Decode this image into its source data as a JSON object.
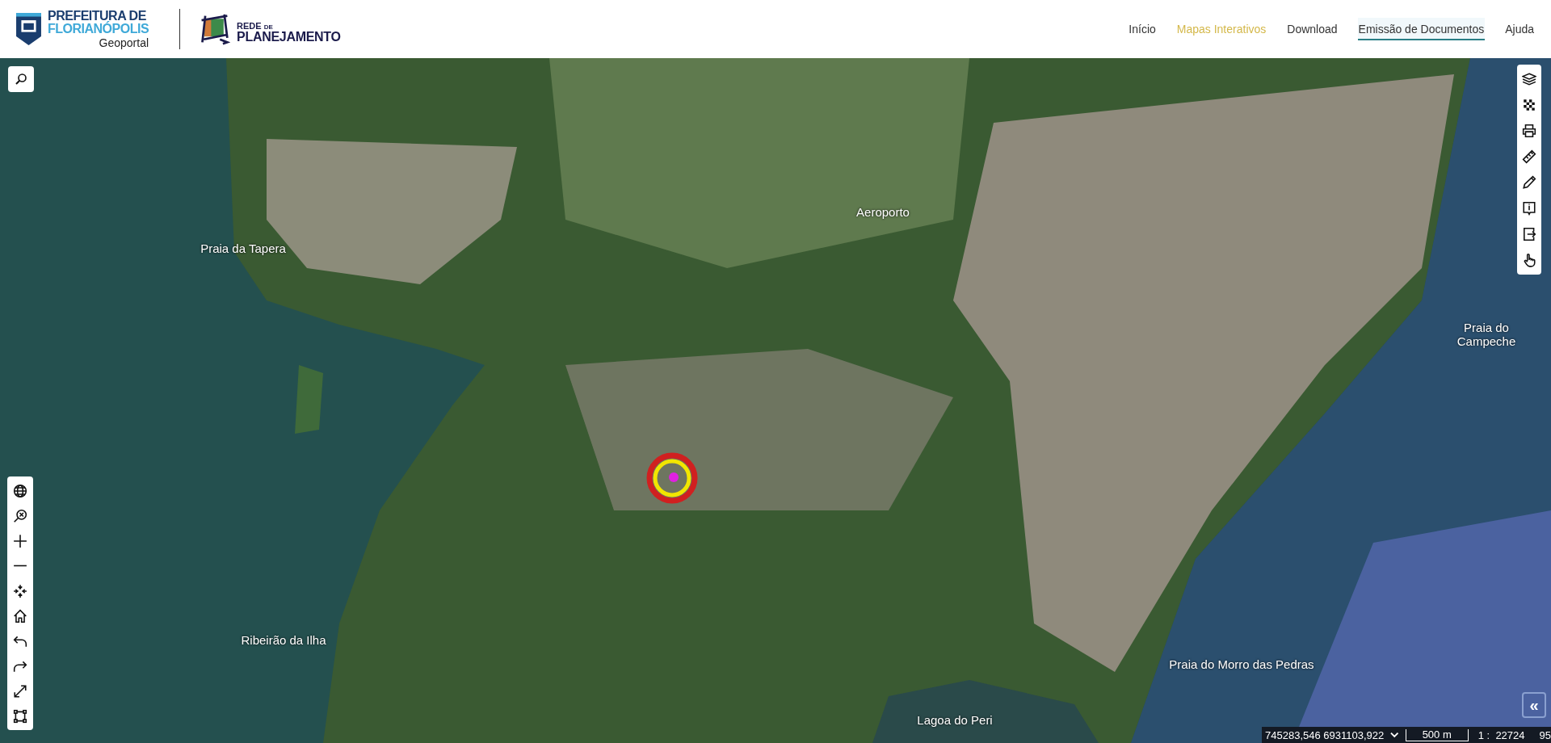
{
  "logos": {
    "prefeitura": {
      "line1": "PREFEITURA DE",
      "line2": "FLORIANÓPOLIS",
      "subtitle": "Geoportal"
    },
    "rede": {
      "line1": "REDE",
      "line1_small": "DE",
      "line2": "PLANEJAMENTO"
    }
  },
  "nav": [
    {
      "label": "Início",
      "selected": false,
      "underlined": false
    },
    {
      "label": "Mapas Interativos",
      "selected": true,
      "underlined": false
    },
    {
      "label": "Download",
      "selected": false,
      "underlined": false
    },
    {
      "label": "Emissão de Documentos",
      "selected": false,
      "underlined": true
    },
    {
      "label": "Ajuda",
      "selected": false,
      "underlined": false
    }
  ],
  "map_labels": [
    {
      "text": "Praia da Tapera",
      "kind": "place"
    },
    {
      "text": "Aeroporto",
      "kind": "place"
    },
    {
      "text": "Praia do Campeche",
      "kind": "place"
    },
    {
      "text": "Ribeirão da Ilha",
      "kind": "place"
    },
    {
      "text": "Praia do Morro das Pedras",
      "kind": "place"
    },
    {
      "text": "Lagoa do Peri",
      "kind": "place"
    }
  ],
  "collapse_button": "«",
  "status_bar": {
    "coordinates": "745283,546 6931103,922",
    "scale_label": "500 m",
    "scale_ratio": "1 :  22724",
    "extra": "95"
  }
}
